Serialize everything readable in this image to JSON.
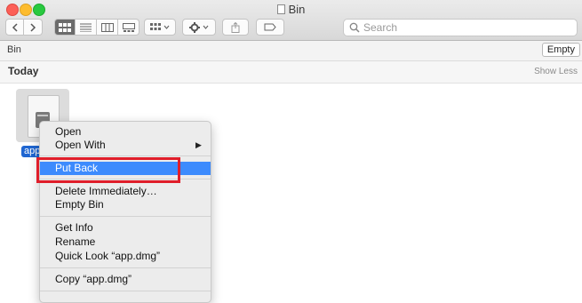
{
  "window": {
    "title": "Bin"
  },
  "toolbar": {
    "view_buttons": [
      "icon-view",
      "list-view",
      "column-view",
      "gallery-view"
    ],
    "search_placeholder": "Search"
  },
  "pathbar": {
    "label": "Bin",
    "empty_label": "Empty"
  },
  "section": {
    "title": "Today",
    "show_less": "Show Less"
  },
  "file": {
    "name": "app"
  },
  "menu": {
    "items": [
      {
        "label": "Open"
      },
      {
        "label": "Open With",
        "arrow": "▶"
      },
      {
        "label": "Put Back"
      },
      {
        "label": "Delete Immediately…"
      },
      {
        "label": "Empty Bin"
      },
      {
        "label": "Get Info"
      },
      {
        "label": "Rename"
      },
      {
        "label": "Quick Look “app.dmg”"
      },
      {
        "label": "Copy “app.dmg”"
      }
    ]
  },
  "colors": {
    "selection": "#3d8bfd",
    "annotation": "#e01e2a"
  }
}
